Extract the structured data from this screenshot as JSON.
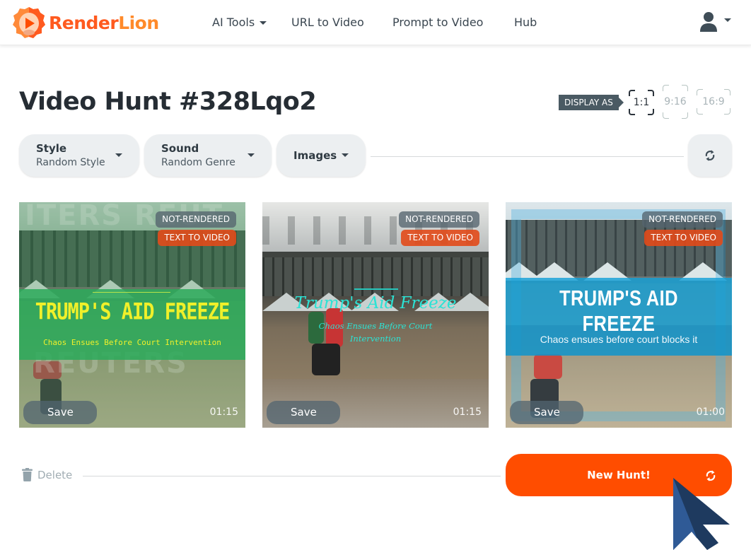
{
  "header": {
    "brand": {
      "part1": "Render",
      "part2": "Lion"
    },
    "nav": [
      {
        "label": "AI Tools",
        "has_dropdown": true
      },
      {
        "label": "URL to Video",
        "has_dropdown": false
      },
      {
        "label": "Prompt to Video",
        "has_dropdown": false
      },
      {
        "label": "Hub",
        "has_dropdown": false
      }
    ],
    "user_menu_icon": "user-icon"
  },
  "page": {
    "title": "Video Hunt #328Lqo2",
    "display_as_label": "DISPLAY AS",
    "ratios": [
      {
        "label": "1:1",
        "active": true
      },
      {
        "label": "9:16",
        "active": false
      },
      {
        "label": "16:9",
        "active": false
      }
    ]
  },
  "filters": {
    "style": {
      "label": "Style",
      "value": "Random Style"
    },
    "sound": {
      "label": "Sound",
      "value": "Random Genre"
    },
    "images": {
      "label": "Images"
    },
    "refresh_icon": "refresh-icon"
  },
  "cards": [
    {
      "status": "NOT-RENDERED",
      "type": "TEXT TO VIDEO",
      "headline": "TRUMP'S AID FREEZE",
      "subheadline": "Chaos Ensues Before Court Intervention",
      "watermark": "REUTERS",
      "save_label": "Save",
      "duration": "01:15"
    },
    {
      "status": "NOT-RENDERED",
      "type": "TEXT TO VIDEO",
      "headline": "Trump's Aid Freeze",
      "subheadline": "Chaos Ensues Before Court Intervention",
      "save_label": "Save",
      "duration": "01:15"
    },
    {
      "status": "NOT-RENDERED",
      "type": "TEXT TO VIDEO",
      "headline": "TRUMP'S AID FREEZE",
      "subheadline": "Chaos ensues before court blocks it",
      "save_label": "Save",
      "duration": "01:00"
    }
  ],
  "footer": {
    "delete_label": "Delete",
    "new_hunt_label": "New Hunt!"
  },
  "colors": {
    "brand_orange": "#ff4d00",
    "badge_orange": "#e24a1a",
    "text_dark": "#262d34",
    "pill_bg": "#eceff1"
  }
}
